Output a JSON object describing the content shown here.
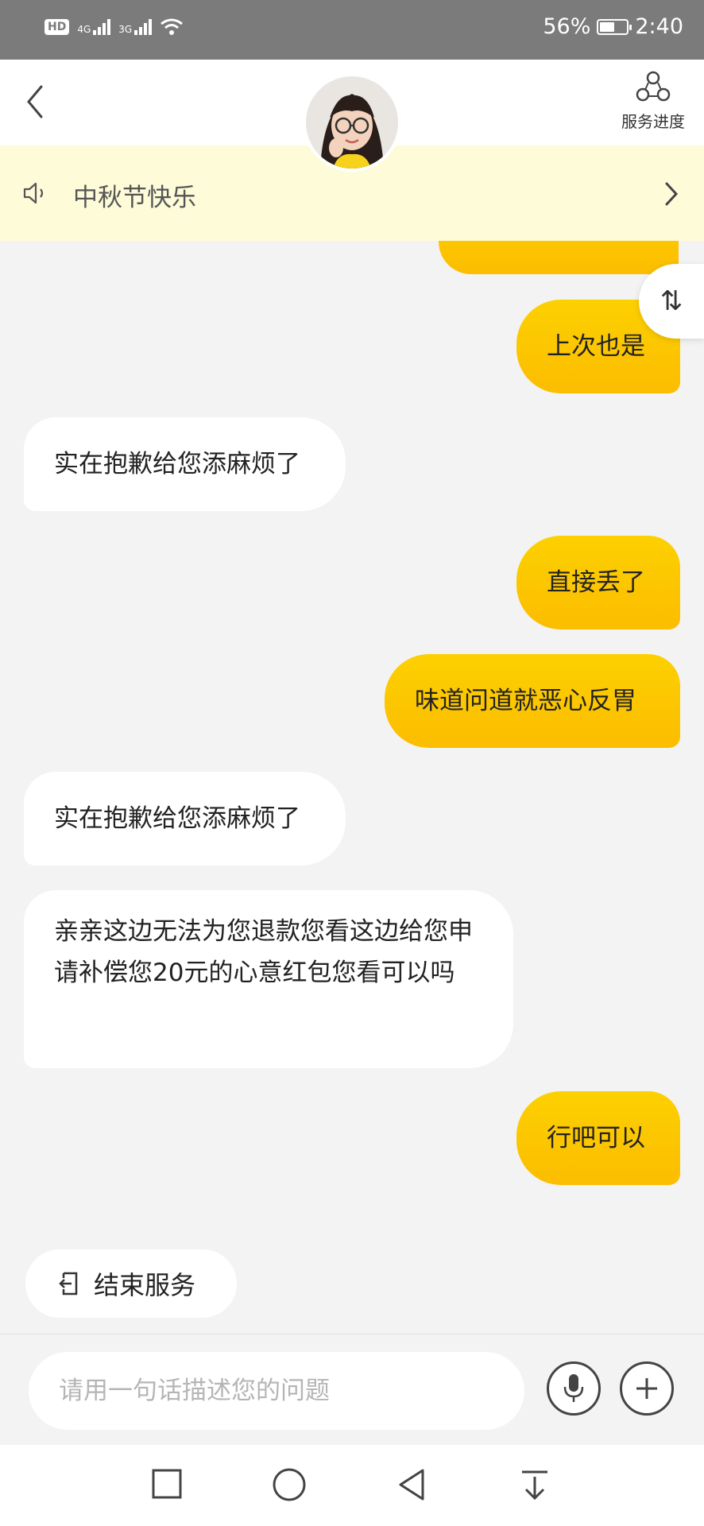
{
  "status_bar": {
    "hd": "HD",
    "sim1": "1",
    "network1": "4G",
    "network2": "3G",
    "battery_percent": "56%",
    "battery_level": 0.56,
    "time": "2:40"
  },
  "header": {
    "back_icon": "chevron-left-icon",
    "service_progress_label": "服务进度",
    "service_progress_icon": "progress-nodes-icon"
  },
  "notice": {
    "text": "中秋节快乐",
    "icon": "speaker-icon"
  },
  "messages": [
    {
      "side": "right",
      "text": ""
    },
    {
      "side": "right",
      "text": "上次也是"
    },
    {
      "side": "left",
      "text": "实在抱歉给您添麻烦了"
    },
    {
      "side": "right",
      "text": "直接丢了"
    },
    {
      "side": "right",
      "text": "味道问道就恶心反胃"
    },
    {
      "side": "left",
      "text": "实在抱歉给您添麻烦了"
    },
    {
      "side": "left",
      "text": "亲亲这边无法为您退款您看这边给您申请补偿您20元的心意红包您看可以吗"
    },
    {
      "side": "right",
      "text": "行吧可以"
    }
  ],
  "sort_button": "⇅",
  "end_service": {
    "label": "结束服务",
    "icon": "exit-icon"
  },
  "input": {
    "placeholder": "请用一句话描述您的问题",
    "value": ""
  },
  "colors": {
    "accent": "#fcc800",
    "notice_bg": "#fefbd9",
    "chat_bg": "#f3f3f3"
  }
}
